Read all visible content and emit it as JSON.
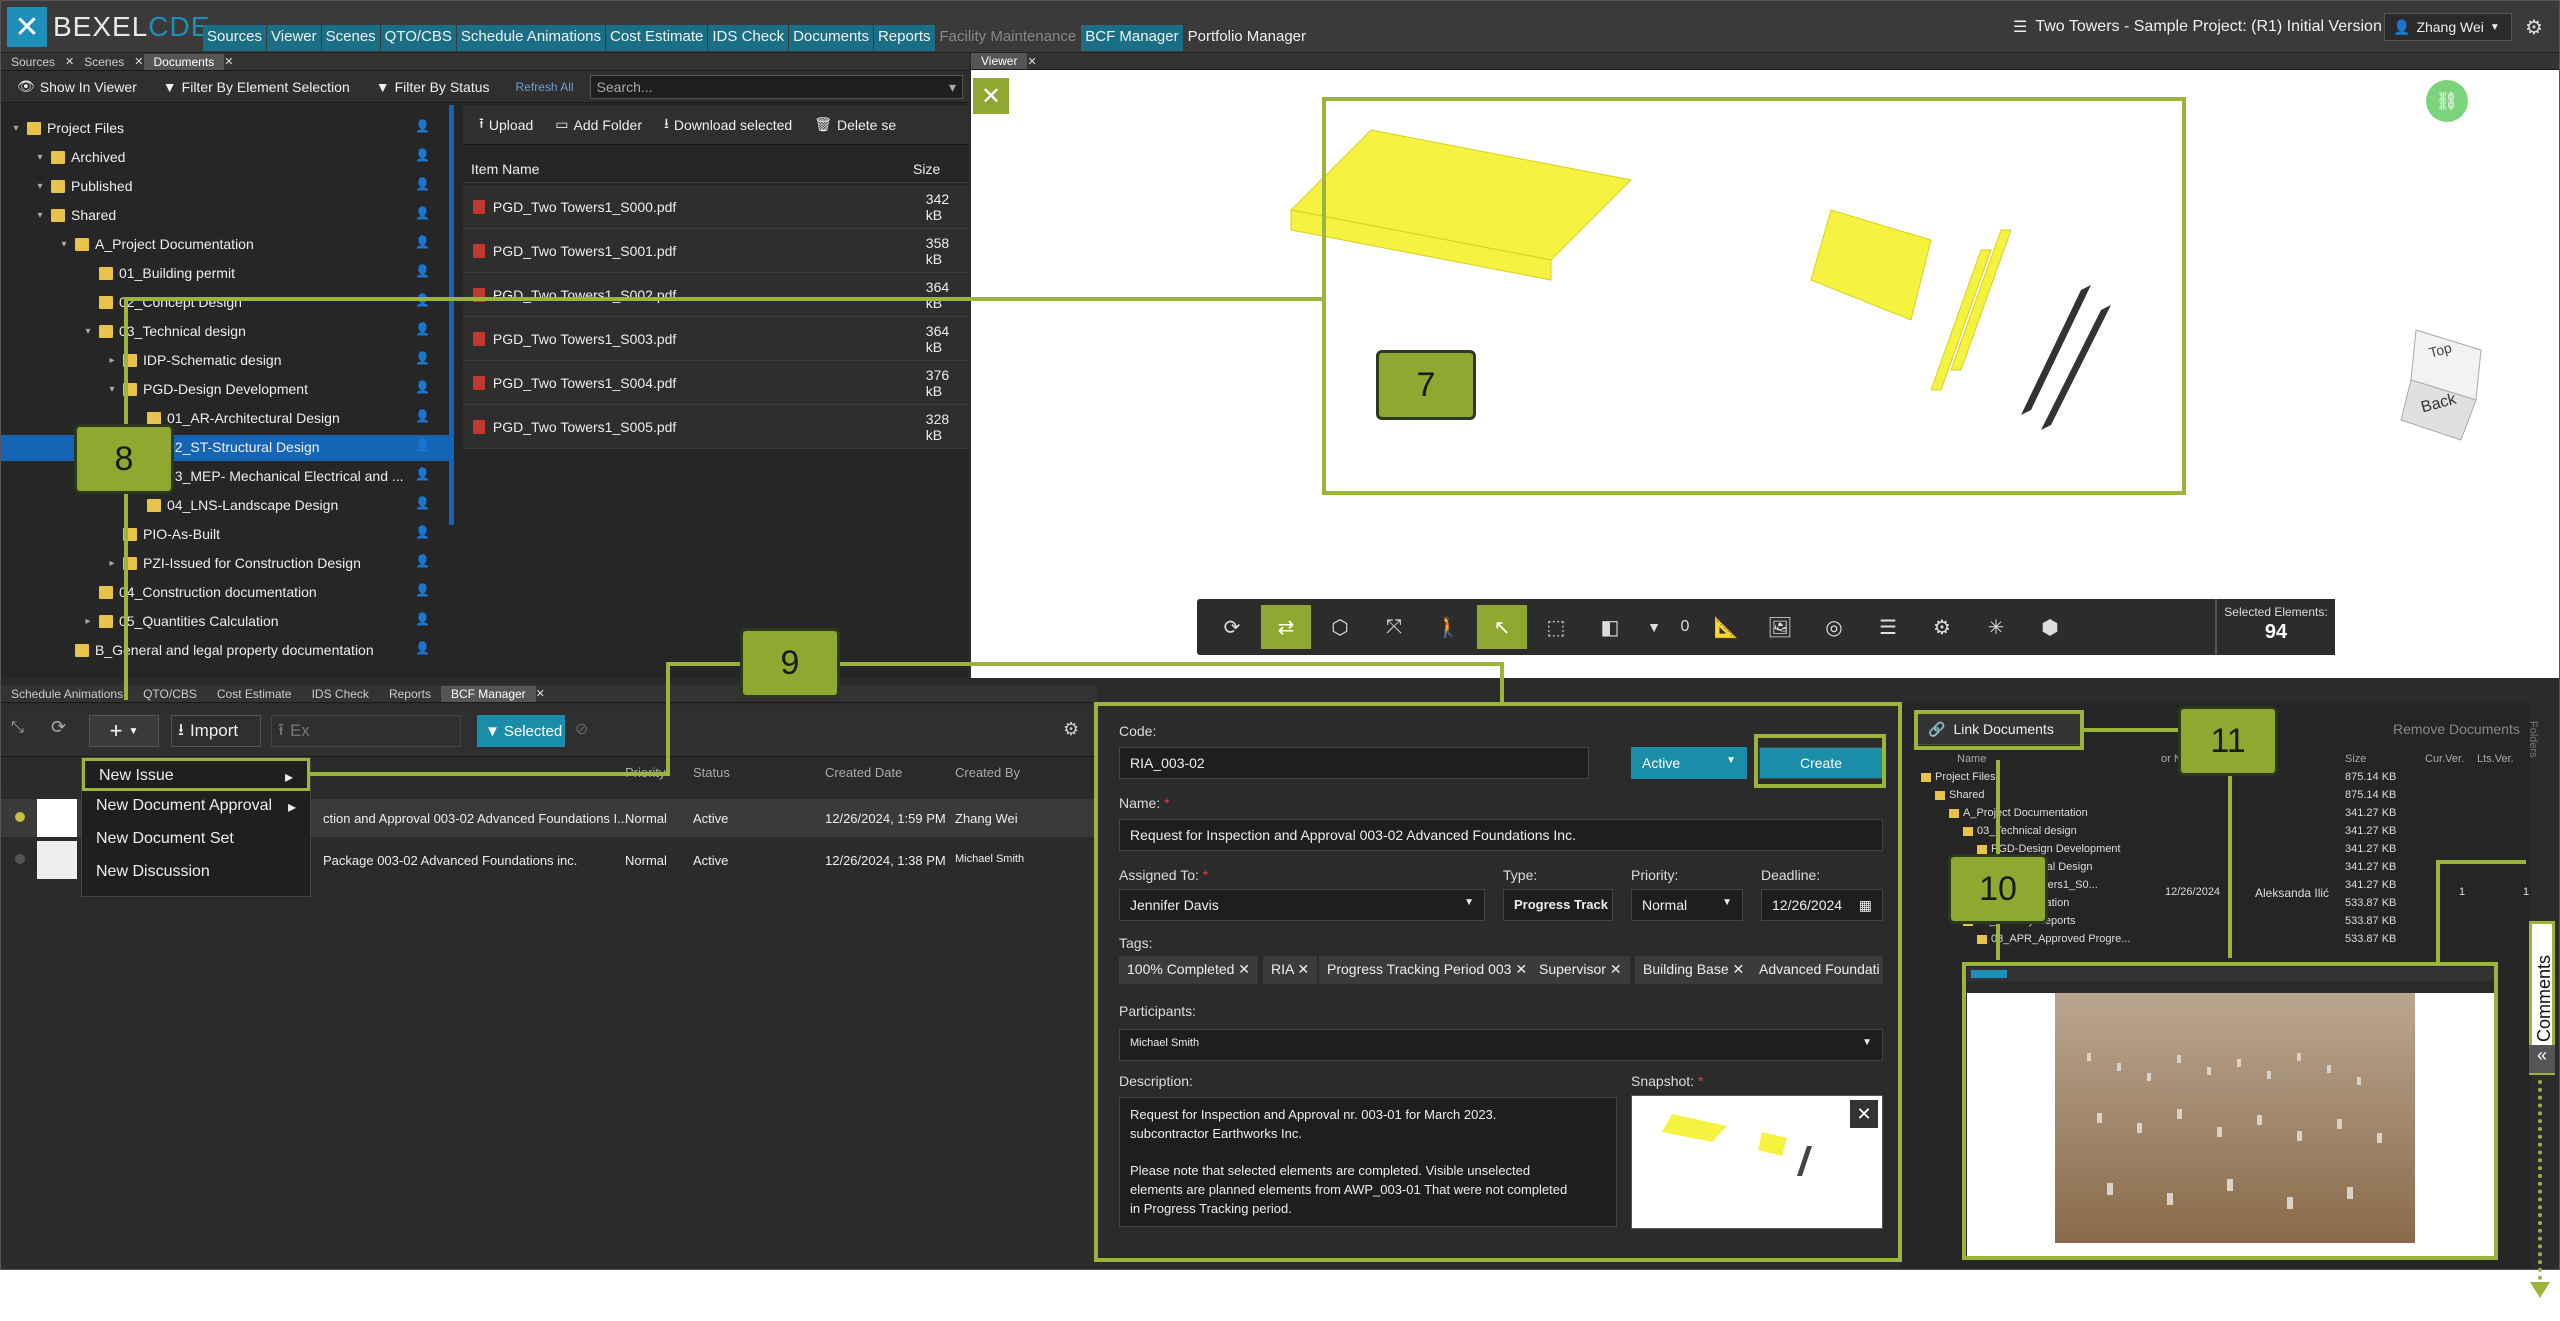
{
  "app": {
    "logo_left": "BEXEL",
    "logo_right": "CDE",
    "menu": [
      "Sources",
      "Viewer",
      "Scenes",
      "QTO/CBS",
      "Schedule Animations",
      "Cost Estimate",
      "IDS Check",
      "Documents",
      "Reports",
      "Facility Maintenance",
      "BCF Manager",
      "Portfolio Manager"
    ],
    "project": "Two Towers - Sample Project: (R1) Initial Version",
    "user": "Zhang Wei"
  },
  "top_tabs": [
    "Sources",
    "Scenes",
    "Documents"
  ],
  "viewer_tab": "Viewer",
  "docs_toolbar": {
    "show": "Show In Viewer",
    "filter_sel": "Filter By Element Selection",
    "filter_status": "Filter By Status",
    "refresh": "Refresh All",
    "search_placeholder": "Search..."
  },
  "tree": [
    "Project Files",
    "Archived",
    "Published",
    "Shared",
    "A_Project Documentation",
    "01_Building permit",
    "02_Concept Design",
    "03_Technical design",
    "IDP-Schematic design",
    "PGD-Design Development",
    "01_AR-Architectural Design",
    "02_ST-Structural Design",
    "03_MEP- Mechanical Electrical and ...",
    "04_LNS-Landscape Design",
    "PIO-As-Built",
    "PZI-Issued for Construction Design",
    "04_Construction documentation",
    "05_Quantities Calculation",
    "B_General and legal property documentation"
  ],
  "files_toolbar": {
    "upload": "Upload",
    "add_folder": "Add Folder",
    "download": "Download selected",
    "delete": "Delete se"
  },
  "files": {
    "head_name": "Item Name",
    "head_size": "Size",
    "rows": [
      {
        "name": "PGD_Two Towers1_S000.pdf",
        "size": "342 kB"
      },
      {
        "name": "PGD_Two Towers1_S001.pdf",
        "size": "358 kB"
      },
      {
        "name": "PGD_Two Towers1_S002.pdf",
        "size": "364 kB"
      },
      {
        "name": "PGD_Two Towers1_S003.pdf",
        "size": "364 kB"
      },
      {
        "name": "PGD_Two Towers1_S004.pdf",
        "size": "376 kB"
      },
      {
        "name": "PGD_Two Towers1_S005.pdf",
        "size": "328 kB"
      }
    ]
  },
  "viewer": {
    "cube_top": "Top",
    "cube_back": "Back",
    "zero": "0",
    "selected_label": "Selected Elements:",
    "selected_value": "94"
  },
  "bottom_tabs": [
    "Schedule Animations",
    "QTO/CBS",
    "Cost Estimate",
    "IDS Check",
    "Reports",
    "BCF Manager"
  ],
  "bcf_toolbar": {
    "import": "Import",
    "export": "Ex",
    "selected": "Selected"
  },
  "dropdown": [
    "New Issue",
    "New Document Approval",
    "New Document Set",
    "New Discussion"
  ],
  "grid": {
    "headers": [
      "Priority",
      "Status",
      "Created Date",
      "Created By"
    ],
    "rows": [
      {
        "title": "ction and Approval 003-02 Advanced Foundations I...",
        "priority": "Normal",
        "status": "Active",
        "date": "12/26/2024, 1:59 PM",
        "by": "Zhang Wei"
      },
      {
        "title": "Package 003-02 Advanced Foundations inc.",
        "priority": "Normal",
        "status": "Active",
        "date": "12/26/2024, 1:38 PM",
        "by": "Michael Smith"
      }
    ]
  },
  "form": {
    "code_label": "Code:",
    "code": "RIA_003-02",
    "status": "Active",
    "create": "Create",
    "name_label": "Name:",
    "name": "Request for Inspection and Approval 003-02 Advanced Foundations Inc.",
    "assigned_label": "Assigned To:",
    "assigned": "Jennifer Davis",
    "type_label": "Type:",
    "type": "Progress Track",
    "priority_label": "Priority:",
    "priority": "Normal",
    "deadline_label": "Deadline:",
    "deadline": "12/26/2024",
    "tags_label": "Tags:",
    "tags": [
      "100% Completed",
      "RIA",
      "Progress Tracking Period 003",
      "Supervisor",
      "Building Base",
      "Advanced Foundati"
    ],
    "participants_label": "Participants:",
    "participant": "Michael Smith",
    "desc_label": "Description:",
    "desc1": "Request for Inspection and Approval nr. 003-01 for March 2023.",
    "desc2": "subcontractor Earthworks Inc.",
    "desc3": "Please note that selected elements are completed. Visible unselected",
    "desc4": "elements are planned elements from AWP_003-01 That were not completed",
    "desc5": "in Progress Tracking period.",
    "snapshot_label": "Snapshot:"
  },
  "right": {
    "link": "Link Documents",
    "remove": "Remove Documents",
    "headers": [
      "Name",
      "or Name",
      "Size",
      "Cur.Ver.",
      "Lts.Ver."
    ],
    "tree": [
      "Project Files",
      "Shared",
      "A_Project Documentation",
      "03_Technical design",
      "PGD-Design Development",
      "ST-Structural Design",
      "D_Two Towers1_S0...",
      "tive documentation",
      "01_Monthly Reports",
      "03_APR_Approved Progre..."
    ],
    "sizes": [
      "875.14 KB",
      "875.14 KB",
      "341.27 KB",
      "341.27 KB",
      "341.27 KB",
      "341.27 KB",
      "341.27 KB",
      "533.87 KB",
      "533.87 KB",
      "533.87 KB"
    ],
    "row_date": "12/26/2024",
    "row_author": "Aleksanda Ilić",
    "cur": "1",
    "lts": "1",
    "comments": "Comments",
    "side_tab": "Folders"
  },
  "callouts": [
    "7",
    "8",
    "9",
    "10",
    "11"
  ]
}
